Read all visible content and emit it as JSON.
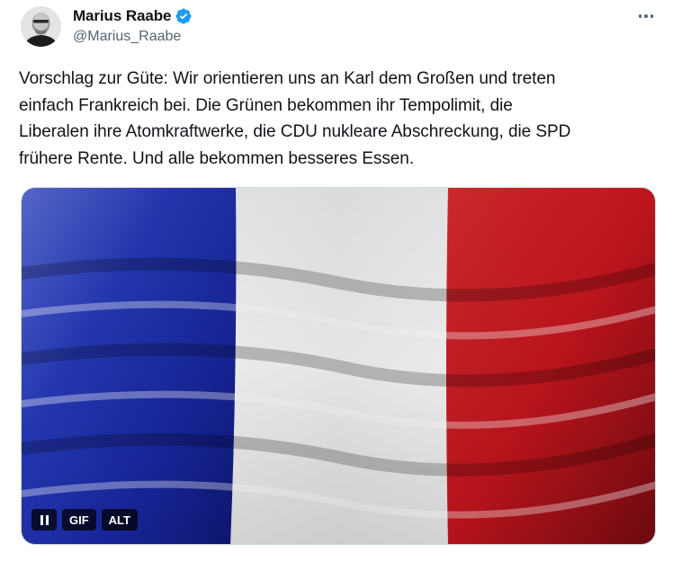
{
  "author": {
    "display_name": "Marius Raabe",
    "handle": "@Marius_Raabe",
    "avatar_icon": "avatar-photo",
    "verified_icon": "verified-badge-icon",
    "verified_color": "#1d9bf0"
  },
  "more_icon": "more-options-icon",
  "tweet": {
    "text": "Vorschlag zur Güte: Wir orientieren uns an Karl dem Großen und treten\neinfach Frankreich bei. Die Grünen bekommen ihr Tempolimit, die\nLiberalen ihre Atomkraftwerke, die CDU nukleare Abschreckung, die SPD\nfrühere Rente. Und alle bekommen besseres Essen."
  },
  "media": {
    "type": "gif",
    "subject": "waving-french-flag",
    "colors": {
      "blue": "#1f2fa8",
      "white": "#f2f2f2",
      "red": "#c3181f"
    },
    "controls": {
      "pause_icon": "pause-icon",
      "gif_label": "GIF",
      "alt_label": "ALT"
    }
  }
}
